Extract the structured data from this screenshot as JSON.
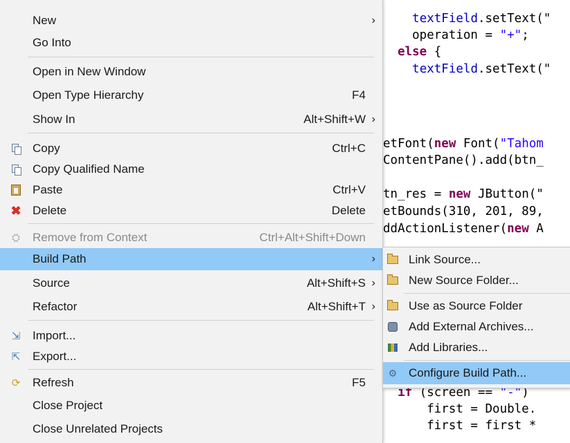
{
  "editor": {
    "lines": [
      [
        {
          "t": "    "
        },
        {
          "t": "textField",
          "c": "fld"
        },
        {
          "t": ".setText(\""
        }
      ],
      [
        {
          "t": "    operation = "
        },
        {
          "t": "\"+\"",
          "c": "str"
        },
        {
          "t": ";"
        }
      ],
      [
        {
          "t": "  "
        },
        {
          "t": "else",
          "c": "kw"
        },
        {
          "t": " {"
        }
      ],
      [
        {
          "t": "    "
        },
        {
          "t": "textField",
          "c": "fld"
        },
        {
          "t": ".setText(\""
        }
      ],
      [
        {
          "t": "etFont("
        },
        {
          "t": "new",
          "c": "kw"
        },
        {
          "t": " Font("
        },
        {
          "t": "\"Tahom",
          "c": "str"
        }
      ],
      [
        {
          "t": "ContentPane().add(btn_"
        }
      ],
      [
        {
          "t": "tn_res = "
        },
        {
          "t": "new",
          "c": "kw"
        },
        {
          "t": " JButton(\""
        }
      ],
      [
        {
          "t": "etBounds(310, 201, 89,"
        }
      ],
      [
        {
          "t": "ddActionListener("
        },
        {
          "t": "new",
          "c": "kw"
        },
        {
          "t": " A"
        }
      ],
      [
        {
          "t": "  "
        },
        {
          "t": "if",
          "c": "kw"
        },
        {
          "t": " (screen == "
        },
        {
          "t": "\"-\"",
          "c": "str"
        },
        {
          "t": ")"
        }
      ],
      [
        {
          "t": "      first = Double."
        }
      ],
      [
        {
          "t": "      first = first *"
        }
      ]
    ]
  },
  "menu": {
    "items": [
      {
        "label": "New",
        "arrow": "›"
      },
      {
        "label": "Go Into"
      },
      {
        "label": "Open in New Window"
      },
      {
        "label": "Open Type Hierarchy",
        "shortcut": "F4"
      },
      {
        "label": "Show In",
        "shortcut": "Alt+Shift+W",
        "arrow": "›"
      },
      {
        "label": "Copy",
        "shortcut": "Ctrl+C",
        "icon": "copy-icon"
      },
      {
        "label": "Copy Qualified Name",
        "icon": "copy-qualified-name-icon"
      },
      {
        "label": "Paste",
        "shortcut": "Ctrl+V",
        "icon": "paste-icon"
      },
      {
        "label": "Delete",
        "shortcut": "Delete",
        "icon": "delete-icon"
      },
      {
        "label": "Remove from Context",
        "shortcut": "Ctrl+Alt+Shift+Down",
        "icon": "remove-from-context-icon",
        "disabled": true
      },
      {
        "label": "Build Path",
        "arrow": "›",
        "highlighted": true
      },
      {
        "label": "Source",
        "shortcut": "Alt+Shift+S",
        "arrow": "›"
      },
      {
        "label": "Refactor",
        "shortcut": "Alt+Shift+T",
        "arrow": "›"
      },
      {
        "label": "Import...",
        "icon": "import-icon"
      },
      {
        "label": "Export...",
        "icon": "export-icon"
      },
      {
        "label": "Refresh",
        "shortcut": "F5",
        "icon": "refresh-icon"
      },
      {
        "label": "Close Project"
      },
      {
        "label": "Close Unrelated Projects"
      }
    ]
  },
  "submenu": {
    "items": [
      {
        "label": "Link Source...",
        "icon": "link-source-icon"
      },
      {
        "label": "New Source Folder...",
        "icon": "new-source-folder-icon"
      },
      {
        "label": "Use as Source Folder",
        "icon": "use-as-source-folder-icon"
      },
      {
        "label": "Add External Archives...",
        "icon": "jar-icon"
      },
      {
        "label": "Add Libraries...",
        "icon": "libraries-icon"
      },
      {
        "label": "Configure Build Path...",
        "icon": "configure-build-path-icon",
        "highlighted": true
      }
    ]
  },
  "colors": {
    "highlight": "#91c9f7",
    "menu_bg": "#f2f2f2",
    "keyword": "#7f0055",
    "string": "#2a00ff",
    "field": "#0000c0",
    "delete_icon": "#d93025"
  }
}
